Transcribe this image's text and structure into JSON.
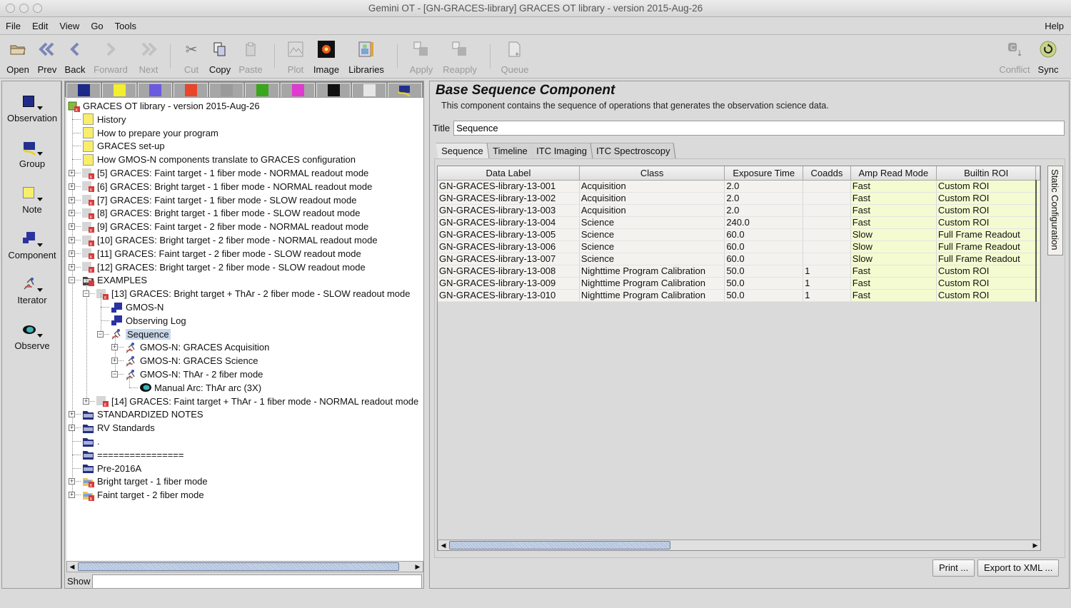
{
  "window": {
    "title": "Gemini OT - [GN-GRACES-library] GRACES OT library - version 2015-Aug-26"
  },
  "menu": {
    "items": [
      "File",
      "Edit",
      "View",
      "Go",
      "Tools"
    ],
    "help": "Help"
  },
  "toolbar": {
    "open": "Open",
    "prev": "Prev",
    "back": "Back",
    "forward": "Forward",
    "next": "Next",
    "cut": "Cut",
    "copy": "Copy",
    "paste": "Paste",
    "plot": "Plot",
    "image": "Image",
    "libraries": "Libraries",
    "apply": "Apply",
    "reapply": "Reapply",
    "queue": "Queue",
    "conflict": "Conflict",
    "sync": "Sync"
  },
  "palette": {
    "observation": "Observation",
    "group": "Group",
    "note": "Note",
    "component": "Component",
    "iterator": "Iterator",
    "observe": "Observe"
  },
  "color_filters": [
    "#1d2a8a",
    "#f3ef2e",
    "#6a5ae0",
    "#e8452a",
    "#9a9a9a",
    "#3aa61c",
    "#e03ad0",
    "#111111",
    "#e6e6e6",
    "group"
  ],
  "tree": {
    "root": "GRACES OT library - version 2015-Aug-26",
    "notes": [
      "History",
      "How to prepare your program",
      "GRACES set-up",
      "How GMOS-N components translate to GRACES configuration"
    ],
    "observations": [
      "[5] GRACES: Faint target - 1 fiber mode - NORMAL readout mode",
      "[6] GRACES: Bright target - 1 fiber mode - NORMAL readout mode",
      "[7] GRACES: Faint target - 1 fiber mode - SLOW readout mode",
      "[8] GRACES: Bright target - 1 fiber mode - SLOW readout mode",
      "[9] GRACES: Faint target - 2 fiber mode - NORMAL readout mode",
      "[10] GRACES: Bright target - 2 fiber mode - NORMAL readout mode",
      "[11] GRACES: Faint target - 2 fiber mode - SLOW readout mode",
      "[12] GRACES: Bright target - 2 fiber mode - SLOW readout mode"
    ],
    "examples": "EXAMPLES",
    "obs13": "[13] GRACES: Bright target + ThAr - 2 fiber mode - SLOW readout mode",
    "gmosn": "GMOS-N",
    "obslog": "Observing Log",
    "sequence": "Sequence",
    "seq_acq": "GMOS-N: GRACES Acquisition",
    "seq_sci": "GMOS-N: GRACES Science",
    "seq_thar": "GMOS-N: ThAr - 2 fiber mode",
    "manual_arc": "Manual Arc: ThAr arc (3X)",
    "obs14": "[14] GRACES: Faint target + ThAr - 1 fiber mode - NORMAL readout mode",
    "folders": [
      "STANDARDIZED NOTES",
      "RV Standards",
      ".",
      "================",
      "Pre-2016A"
    ],
    "groups": [
      "Bright target - 1 fiber mode",
      "Faint target  - 2 fiber mode"
    ]
  },
  "show": {
    "label": "Show",
    "value": ""
  },
  "editor": {
    "heading": "Base Sequence Component",
    "description": "This component contains the sequence of operations that generates the observation science data.",
    "title_label": "Title",
    "title_value": "Sequence",
    "tabs": [
      "Sequence",
      "Timeline",
      "ITC Imaging",
      "ITC Spectroscopy"
    ],
    "static_config": "Static Configuration",
    "print": "Print ...",
    "export": "Export to XML ..."
  },
  "table": {
    "columns": [
      "Data Label",
      "Class",
      "Exposure Time",
      "Coadds",
      "Amp Read Mode",
      "Builtin ROI"
    ],
    "rows": [
      [
        "GN-GRACES-library-13-001",
        "Acquisition",
        "2.0",
        "",
        "Fast",
        "Custom ROI"
      ],
      [
        "GN-GRACES-library-13-002",
        "Acquisition",
        "2.0",
        "",
        "Fast",
        "Custom ROI"
      ],
      [
        "GN-GRACES-library-13-003",
        "Acquisition",
        "2.0",
        "",
        "Fast",
        "Custom ROI"
      ],
      [
        "GN-GRACES-library-13-004",
        "Science",
        "240.0",
        "",
        "Fast",
        "Custom ROI"
      ],
      [
        "GN-GRACES-library-13-005",
        "Science",
        "60.0",
        "",
        "Slow",
        "Full Frame Readout"
      ],
      [
        "GN-GRACES-library-13-006",
        "Science",
        "60.0",
        "",
        "Slow",
        "Full Frame Readout"
      ],
      [
        "GN-GRACES-library-13-007",
        "Science",
        "60.0",
        "",
        "Slow",
        "Full Frame Readout"
      ],
      [
        "GN-GRACES-library-13-008",
        "Nighttime Program Calibration",
        "50.0",
        "1",
        "Fast",
        "Custom ROI"
      ],
      [
        "GN-GRACES-library-13-009",
        "Nighttime Program Calibration",
        "50.0",
        "1",
        "Fast",
        "Custom ROI"
      ],
      [
        "GN-GRACES-library-13-010",
        "Nighttime Program Calibration",
        "50.0",
        "1",
        "Fast",
        "Custom ROI"
      ]
    ]
  }
}
